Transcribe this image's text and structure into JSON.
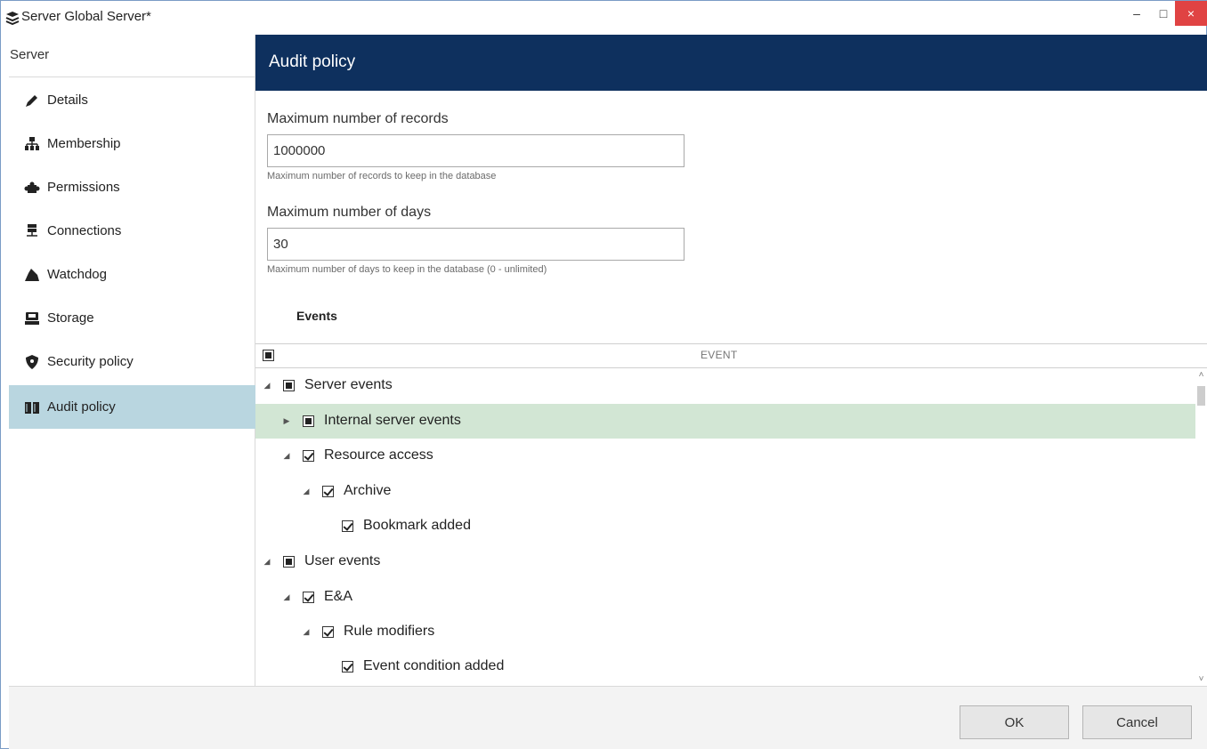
{
  "window": {
    "title": "Server Global Server*",
    "controls": {
      "minimize": "–",
      "maximize": "□",
      "close": "×"
    }
  },
  "sidebar": {
    "header": "Server",
    "items": [
      {
        "label": "Details",
        "icon": "pencil-icon"
      },
      {
        "label": "Membership",
        "icon": "hierarchy-icon"
      },
      {
        "label": "Permissions",
        "icon": "puzzle-icon"
      },
      {
        "label": "Connections",
        "icon": "network-icon"
      },
      {
        "label": "Watchdog",
        "icon": "dog-icon"
      },
      {
        "label": "Storage",
        "icon": "hard-drive-icon"
      },
      {
        "label": "Security policy",
        "icon": "shield-icon"
      },
      {
        "label": "Audit policy",
        "icon": "book-icon",
        "selected": true
      }
    ]
  },
  "main": {
    "title": "Audit policy",
    "max_records": {
      "label": "Maximum number of records",
      "value": "1000000",
      "hint": "Maximum number of records to keep in the database"
    },
    "max_days": {
      "label": "Maximum number of days",
      "value": "30",
      "hint": "Maximum number of days to keep in the database (0 - unlimited)"
    },
    "events_heading": "Events",
    "grid": {
      "column_header": "EVENT",
      "rows": [
        {
          "label": "Server events",
          "level": 0,
          "expander": "expanded",
          "check": "partial"
        },
        {
          "label": "Internal server events",
          "level": 1,
          "expander": "collapsed",
          "check": "partial",
          "highlighted": true
        },
        {
          "label": "Resource access",
          "level": 1,
          "expander": "expanded",
          "check": "checked"
        },
        {
          "label": "Archive",
          "level": 2,
          "expander": "expanded",
          "check": "checked"
        },
        {
          "label": "Bookmark added",
          "level": 3,
          "expander": "none",
          "check": "checked"
        },
        {
          "label": "User events",
          "level": 0,
          "expander": "expanded",
          "check": "partial"
        },
        {
          "label": "E&A",
          "level": 1,
          "expander": "expanded",
          "check": "checked"
        },
        {
          "label": "Rule modifiers",
          "level": 2,
          "expander": "expanded",
          "check": "checked"
        },
        {
          "label": "Event condition added",
          "level": 3,
          "expander": "none",
          "check": "checked"
        }
      ]
    }
  },
  "footer": {
    "ok_label": "OK",
    "cancel_label": "Cancel"
  },
  "colors": {
    "header_bg": "#0e305e",
    "selected_nav": "#b9d6e0",
    "highlight_row": "#d2e6d4",
    "close_button": "#e04343"
  }
}
